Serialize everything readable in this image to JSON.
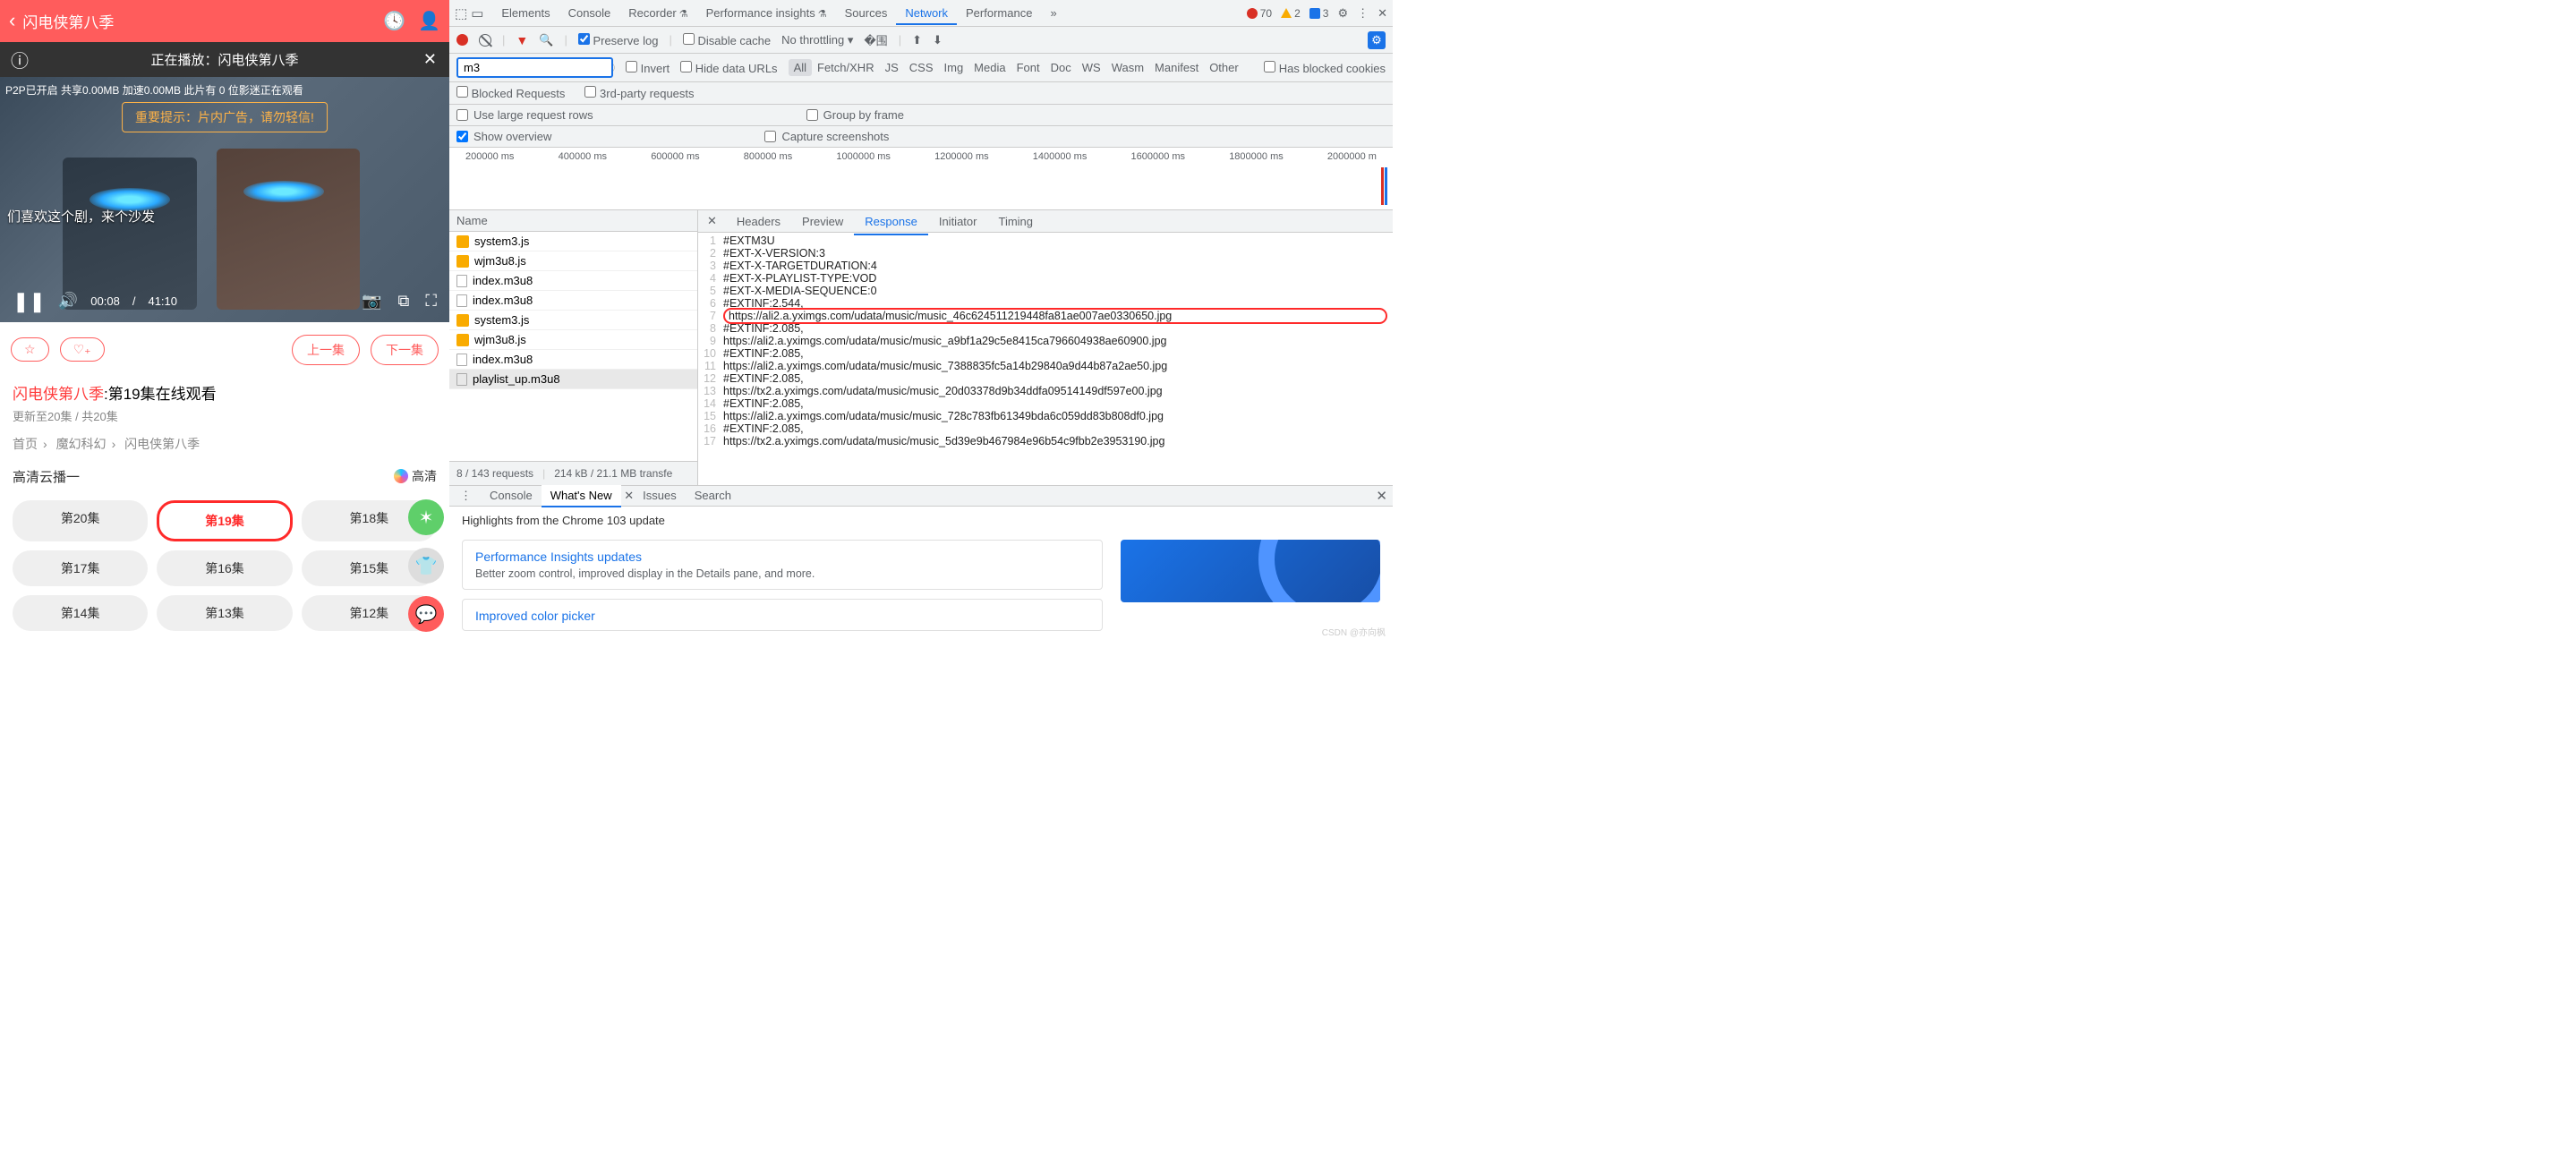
{
  "left": {
    "header_title": "闪电侠第八季",
    "playing_label": "正在播放：闪电侠第八季",
    "p2p": "P2P已开启 共享0.00MB 加速0.00MB 此片有 0 位影迷正在观看",
    "warn": "重要提示：片内广告，请勿轻信!",
    "sofa": "们喜欢这个剧，来个沙发",
    "time_cur": "00:08",
    "time_dur": "41:10",
    "prev": "上一集",
    "next": "下一集",
    "title_red": "闪电侠第八季",
    "title_tail": ":第19集在线观看",
    "sub": "更新至20集 / 共20集",
    "crumb1": "首页",
    "crumb2": "魔幻科幻",
    "crumb3": "闪电侠第八季",
    "source": "高清云播一",
    "hd": "高清",
    "episodes": [
      "第20集",
      "第19集",
      "第18集",
      "第17集",
      "第16集",
      "第15集",
      "第14集",
      "第13集",
      "第12集"
    ],
    "active_ep": 1
  },
  "dt": {
    "tabs": [
      "Elements",
      "Console",
      "Recorder",
      "Performance insights",
      "Sources",
      "Network",
      "Performance"
    ],
    "active_tab": 5,
    "err": "70",
    "warn": "2",
    "info": "3",
    "preserve": "Preserve log",
    "disable_cache": "Disable cache",
    "throttling": "No throttling",
    "filter_value": "m3",
    "invert": "Invert",
    "hide_urls": "Hide data URLs",
    "types": [
      "All",
      "Fetch/XHR",
      "JS",
      "CSS",
      "Img",
      "Media",
      "Font",
      "Doc",
      "WS",
      "Wasm",
      "Manifest",
      "Other"
    ],
    "active_type": 0,
    "blocked_cookies": "Has blocked cookies",
    "blocked_req": "Blocked Requests",
    "third_party": "3rd-party requests",
    "large_rows": "Use large request rows",
    "group_frame": "Group by frame",
    "show_overview": "Show overview",
    "capture": "Capture screenshots",
    "ticks": [
      "200000 ms",
      "400000 ms",
      "600000 ms",
      "800000 ms",
      "1000000 ms",
      "1200000 ms",
      "1400000 ms",
      "1600000 ms",
      "1800000 ms",
      "2000000 m"
    ],
    "name_hdr": "Name",
    "files": [
      {
        "icon": "js",
        "name": "system3.js"
      },
      {
        "icon": "js",
        "name": "wjm3u8.js"
      },
      {
        "icon": "doc",
        "name": "index.m3u8"
      },
      {
        "icon": "doc",
        "name": "index.m3u8"
      },
      {
        "icon": "js",
        "name": "system3.js"
      },
      {
        "icon": "js",
        "name": "wjm3u8.js"
      },
      {
        "icon": "doc",
        "name": "index.m3u8"
      },
      {
        "icon": "doc",
        "name": "playlist_up.m3u8"
      }
    ],
    "selected_file": 7,
    "footer_a": "8 / 143 requests",
    "footer_b": "214 kB / 21.1 MB transfe",
    "dtabs": [
      "Headers",
      "Preview",
      "Response",
      "Initiator",
      "Timing"
    ],
    "active_dtab": 2,
    "resp": [
      "#EXTM3U",
      "#EXT-X-VERSION:3",
      "#EXT-X-TARGETDURATION:4",
      "#EXT-X-PLAYLIST-TYPE:VOD",
      "#EXT-X-MEDIA-SEQUENCE:0",
      "#EXTINF:2.544,",
      "https://ali2.a.yximgs.com/udata/music/music_46c624511219448fa81ae007ae0330650.jpg",
      "#EXTINF:2.085,",
      "https://ali2.a.yximgs.com/udata/music/music_a9bf1a29c5e8415ca796604938ae60900.jpg",
      "#EXTINF:2.085,",
      "https://ali2.a.yximgs.com/udata/music/music_7388835fc5a14b29840a9d44b87a2ae50.jpg",
      "#EXTINF:2.085,",
      "https://tx2.a.yximgs.com/udata/music/music_20d03378d9b34ddfa09514149df597e00.jpg",
      "#EXTINF:2.085,",
      "https://ali2.a.yximgs.com/udata/music/music_728c783fb61349bda6c059dd83b808df0.jpg",
      "#EXTINF:2.085,",
      "https://tx2.a.yximgs.com/udata/music/music_5d39e9b467984e96b54c9fbb2e3953190.jpg"
    ],
    "hl_line": 6,
    "drawer_tabs": [
      "Console",
      "What's New",
      "Issues",
      "Search"
    ],
    "drawer_active": 1,
    "drawer_heading": "Highlights from the Chrome 103 update",
    "card1_t": "Performance Insights updates",
    "card1_s": "Better zoom control, improved display in the Details pane, and more.",
    "card2_t": "Improved color picker",
    "watermark": "CSDN @亦向枫"
  }
}
